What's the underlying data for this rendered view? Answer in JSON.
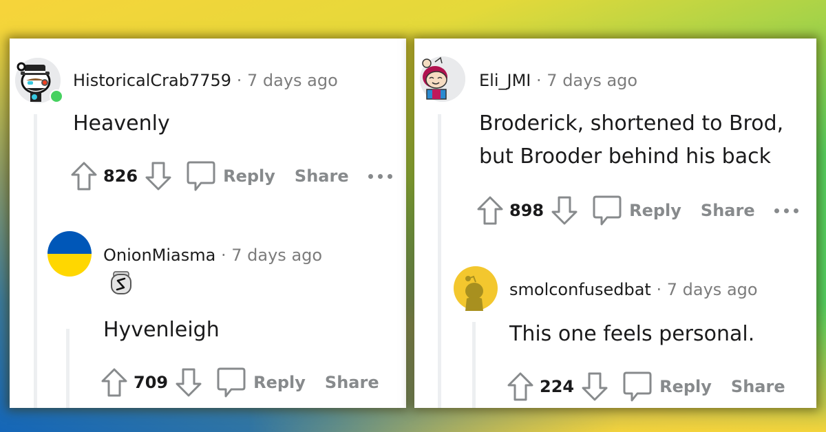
{
  "colors": {
    "username": "#1c1c1c",
    "timestamp": "#7c7c7c",
    "action_gray": "#878a8c",
    "thread_line": "#edeff1",
    "online": "#46d160"
  },
  "left_panel": {
    "parent": {
      "avatar_icon": "snoo-avatar-top-hat",
      "online": true,
      "username": "HistoricalCrab7759",
      "separator": "·",
      "timestamp": "7 days ago",
      "body": "Heavenly",
      "score": "826",
      "reply_label": "Reply",
      "share_label": "Share",
      "more_icon": "more-dots"
    },
    "reply": {
      "avatar_icon": "ukraine-flag-avatar",
      "username": "OnionMiasma",
      "separator": "·",
      "timestamp": "7 days ago",
      "flair_icon": "s-badge",
      "body": "Hyvenleigh",
      "score": "709",
      "reply_label": "Reply",
      "share_label": "Share"
    }
  },
  "right_panel": {
    "parent": {
      "avatar_icon": "snoo-avatar-red-hair",
      "username": "Eli_JMI",
      "separator": "·",
      "timestamp": "7 days ago",
      "body_lines": [
        "Broderick, shortened to Brod,",
        "but Brooder behind his back"
      ],
      "score": "898",
      "reply_label": "Reply",
      "share_label": "Share",
      "more_icon": "more-dots"
    },
    "reply": {
      "avatar_icon": "default-snoo-yellow",
      "username": "smolconfusedbat",
      "separator": "·",
      "timestamp": "7 days ago",
      "body": "This one feels personal.",
      "score": "224",
      "reply_label": "Reply",
      "share_label": "Share"
    }
  }
}
